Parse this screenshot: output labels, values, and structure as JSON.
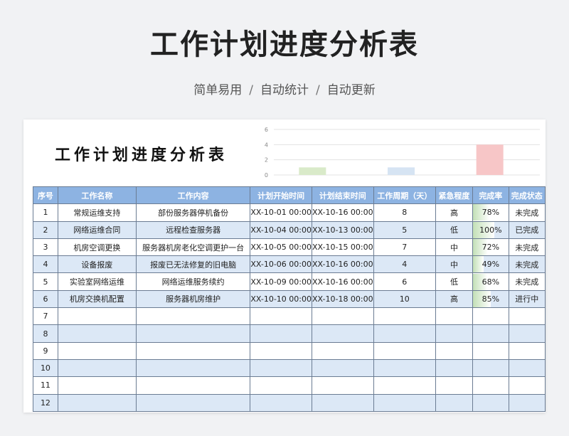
{
  "hero": {
    "title": "工作计划进度分析表",
    "subtitle_parts": [
      "简单易用",
      "自动统计",
      "自动更新"
    ],
    "separator": "/"
  },
  "sheet": {
    "title": "工作计划进度分析表"
  },
  "chart_data": {
    "type": "bar",
    "title": "",
    "ylim": [
      0,
      6
    ],
    "yticks": [
      "0",
      "2",
      "4",
      "6"
    ],
    "categories": [
      "",
      "",
      ""
    ],
    "series": [
      {
        "values": [
          1,
          1,
          4
        ]
      }
    ],
    "colors": [
      "#d9eac9",
      "#d6e4f3",
      "#f7c6c7"
    ],
    "grid": true
  },
  "table": {
    "headers": [
      "序号",
      "工作名称",
      "工作内容",
      "计划开始时间",
      "计划结束时间",
      "工作周期（天）",
      "紧急程度",
      "完成率",
      "完成状态"
    ],
    "rows": [
      {
        "no": "1",
        "name": "常规运维支持",
        "content": "部份服务器停机备份",
        "start": "XX-10-01 00:00",
        "end": "XX-10-16 00:00",
        "days": "8",
        "urgency": "高",
        "rate": "78%",
        "rate_value": 0.78,
        "status": "未完成"
      },
      {
        "no": "2",
        "name": "网络运维合同",
        "content": "远程检查服务器",
        "start": "XX-10-04 00:00",
        "end": "XX-10-13 00:00",
        "days": "5",
        "urgency": "低",
        "rate": "100%",
        "rate_value": 1.0,
        "status": "已完成"
      },
      {
        "no": "3",
        "name": "机房空调更换",
        "content": "服务器机房老化空调更护一台",
        "start": "XX-10-05 00:00",
        "end": "XX-10-15 00:00",
        "days": "7",
        "urgency": "中",
        "rate": "72%",
        "rate_value": 0.72,
        "status": "未完成"
      },
      {
        "no": "4",
        "name": "设备报废",
        "content": "报废已无法修复的旧电脑",
        "start": "XX-10-06 00:00",
        "end": "XX-10-16 00:00",
        "days": "4",
        "urgency": "中",
        "rate": "49%",
        "rate_value": 0.49,
        "status": "未完成"
      },
      {
        "no": "5",
        "name": "实验室网络运维",
        "content": "网络运维服务续约",
        "start": "XX-10-09 00:00",
        "end": "XX-10-16 00:00",
        "days": "6",
        "urgency": "低",
        "rate": "68%",
        "rate_value": 0.68,
        "status": "未完成"
      },
      {
        "no": "6",
        "name": "机房交换机配置",
        "content": "服务器机房维护",
        "start": "XX-10-10 00:00",
        "end": "XX-10-18 00:00",
        "days": "10",
        "urgency": "高",
        "rate": "85%",
        "rate_value": 0.85,
        "status": "进行中"
      },
      {
        "no": "7"
      },
      {
        "no": "8"
      },
      {
        "no": "9"
      },
      {
        "no": "10"
      },
      {
        "no": "11"
      },
      {
        "no": "12"
      }
    ]
  }
}
